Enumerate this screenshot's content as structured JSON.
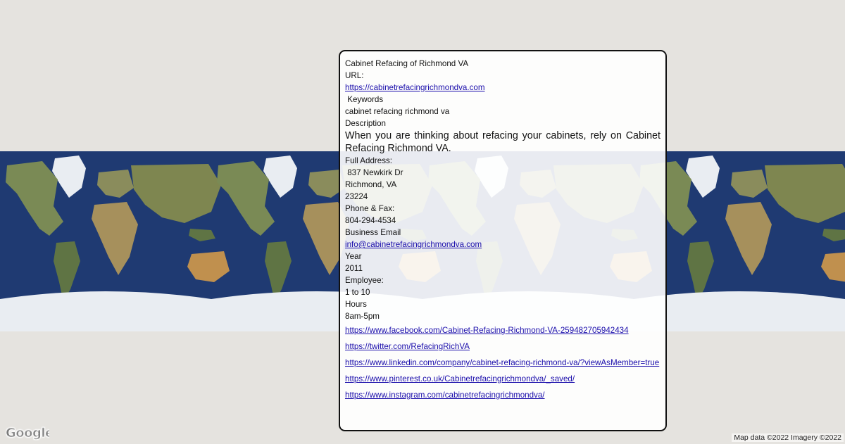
{
  "business": {
    "name": "Cabinet Refacing of Richmond VA",
    "url_label": "URL:",
    "url": "https://cabinetrefacingrichmondva.com",
    "keywords_label": " Keywords",
    "keywords": "cabinet refacing richmond va",
    "description_label": "Description",
    "description": "When you are thinking about refacing your cabinets, rely on Cabinet Refacing Richmond VA.",
    "address_label": "Full Address:",
    "address_street": " 837 Newkirk Dr",
    "address_city": "Richmond, VA",
    "address_zip": "23224",
    "phone_label": "Phone & Fax:",
    "phone": "804-294-4534",
    "email_label": "Business Email",
    "email": "info@cabinetrefacingrichmondva.com",
    "year_label": "Year",
    "year": "2011",
    "employee_label": "Employee:",
    "employee": "1 to 10",
    "hours_label": "Hours",
    "hours": "8am-5pm"
  },
  "social_links": [
    "https://www.facebook.com/Cabinet-Refacing-Richmond-VA-259482705942434",
    "https://twitter.com/RefacingRichVA",
    "https://www.linkedin.com/company/cabinet-refacing-richmond-va/?viewAsMember=true",
    "https://www.pinterest.co.uk/Cabinetrefacingrichmondva/_saved/",
    "https://www.instagram.com/cabinetrefacingrichmondva/"
  ],
  "map": {
    "logo": "Google",
    "attribution": "Map data ©2022 Imagery ©2022",
    "colors": {
      "ocean": "#1f3a72",
      "land": "#7a8a55",
      "ice": "#e9edf2",
      "background": "#e5e3df"
    }
  }
}
